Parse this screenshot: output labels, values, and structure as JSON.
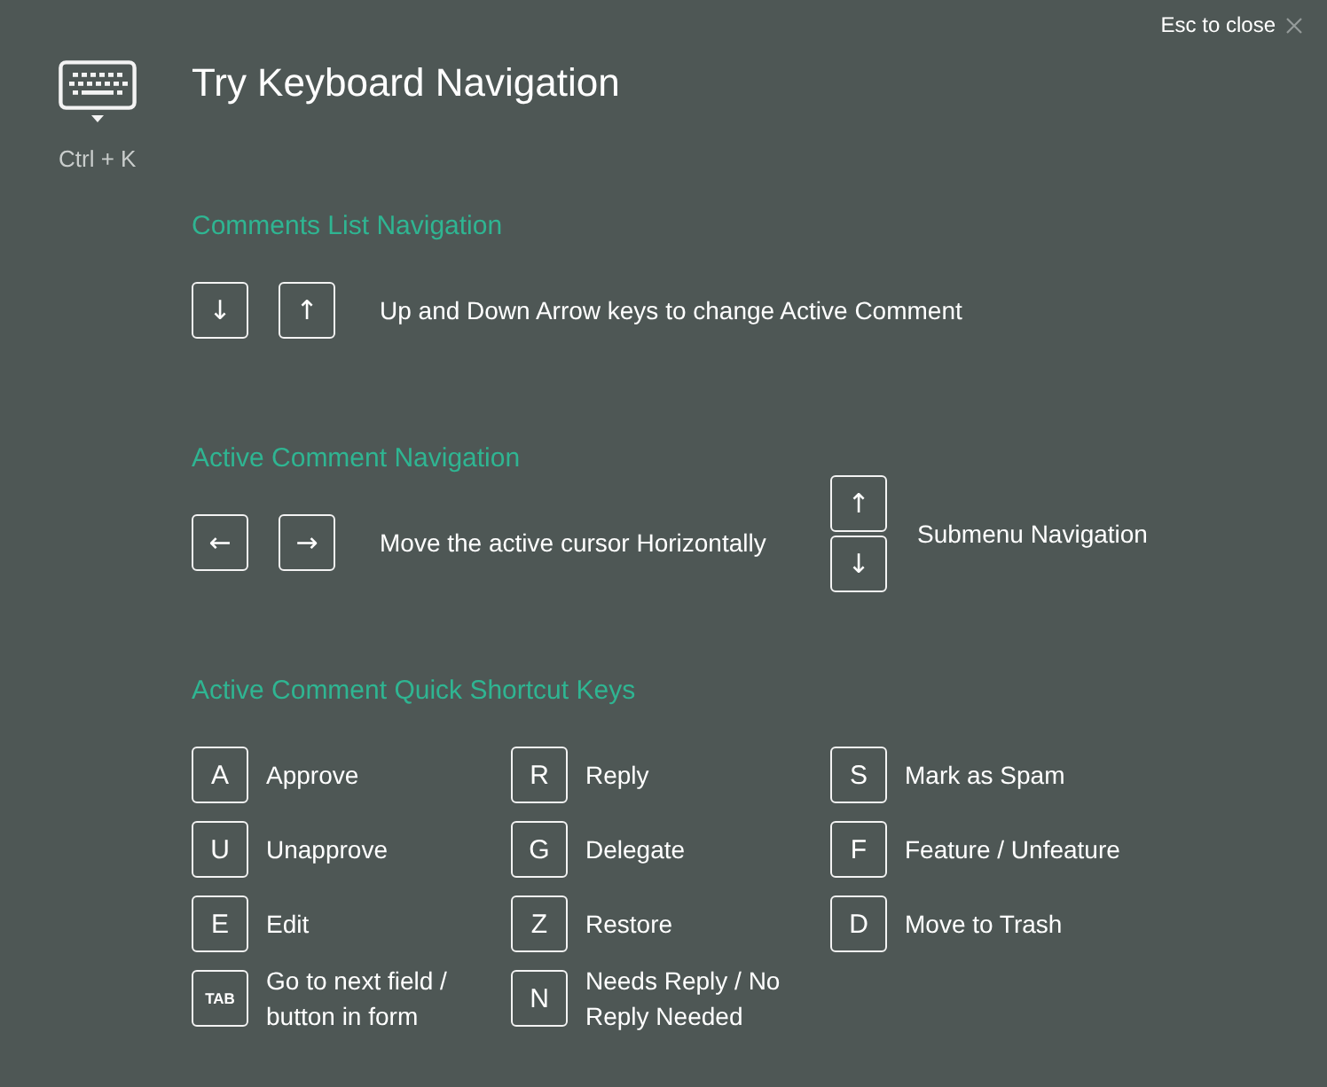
{
  "close": {
    "label": "Esc to close"
  },
  "hotkey": {
    "label": "Ctrl + K"
  },
  "title": "Try Keyboard Navigation",
  "sections": [
    {
      "kind": "arrow_keys",
      "heading": "Comments List Navigation",
      "groups": [
        {
          "kind": "row",
          "keys": [
            "↓",
            "↑"
          ],
          "description": "Up and Down Arrow keys to change Active Comment"
        }
      ]
    },
    {
      "kind": "arrow_keys",
      "heading": "Active Comment Navigation",
      "groups": [
        {
          "kind": "row",
          "keys": [
            "←",
            "→"
          ],
          "description": "Move the active cursor Horizontally"
        },
        {
          "kind": "stack",
          "keys": [
            "↑",
            "↓"
          ],
          "description": "Submenu Navigation"
        }
      ]
    },
    {
      "kind": "shortcut_grid",
      "heading": "Active Comment Quick Shortcut Keys",
      "shortcuts": [
        {
          "kind": "letter",
          "key": "A",
          "action": "Approve"
        },
        {
          "kind": "letter",
          "key": "R",
          "action": "Reply"
        },
        {
          "kind": "letter",
          "key": "S",
          "action": "Mark as Spam"
        },
        {
          "kind": "letter",
          "key": "U",
          "action": "Unapprove"
        },
        {
          "kind": "letter",
          "key": "G",
          "action": "Delegate"
        },
        {
          "kind": "letter",
          "key": "F",
          "action": "Feature / Unfeature"
        },
        {
          "kind": "letter",
          "key": "E",
          "action": "Edit"
        },
        {
          "kind": "letter",
          "key": "Z",
          "action": "Restore"
        },
        {
          "kind": "letter",
          "key": "D",
          "action": "Move to Trash"
        },
        {
          "kind": "word",
          "key": "TAB",
          "action": "Go to next field / button in form"
        },
        {
          "kind": "letter",
          "key": "N",
          "action": "Needs Reply / No Reply Needed"
        }
      ]
    }
  ]
}
